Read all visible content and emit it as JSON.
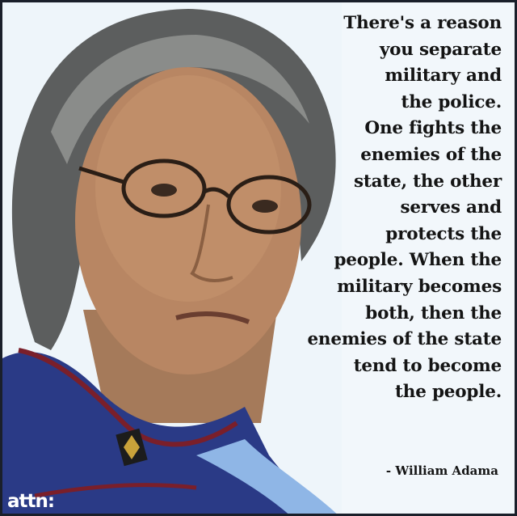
{
  "quote": {
    "lines": [
      "There's a reason",
      "you separate",
      "military and",
      "the police.",
      "One fights the",
      "enemies of the",
      "state, the other",
      "serves and",
      "protects the",
      "people. When the",
      "military becomes",
      "both, then the",
      "enemies of the state",
      "tend to become",
      "the people."
    ],
    "attribution": "- William Adama"
  },
  "logo": "attn:",
  "colors": {
    "background": "#f2f7fb",
    "text": "#141414",
    "uniform": "#2a3a86",
    "border": "#1a1f2a"
  }
}
